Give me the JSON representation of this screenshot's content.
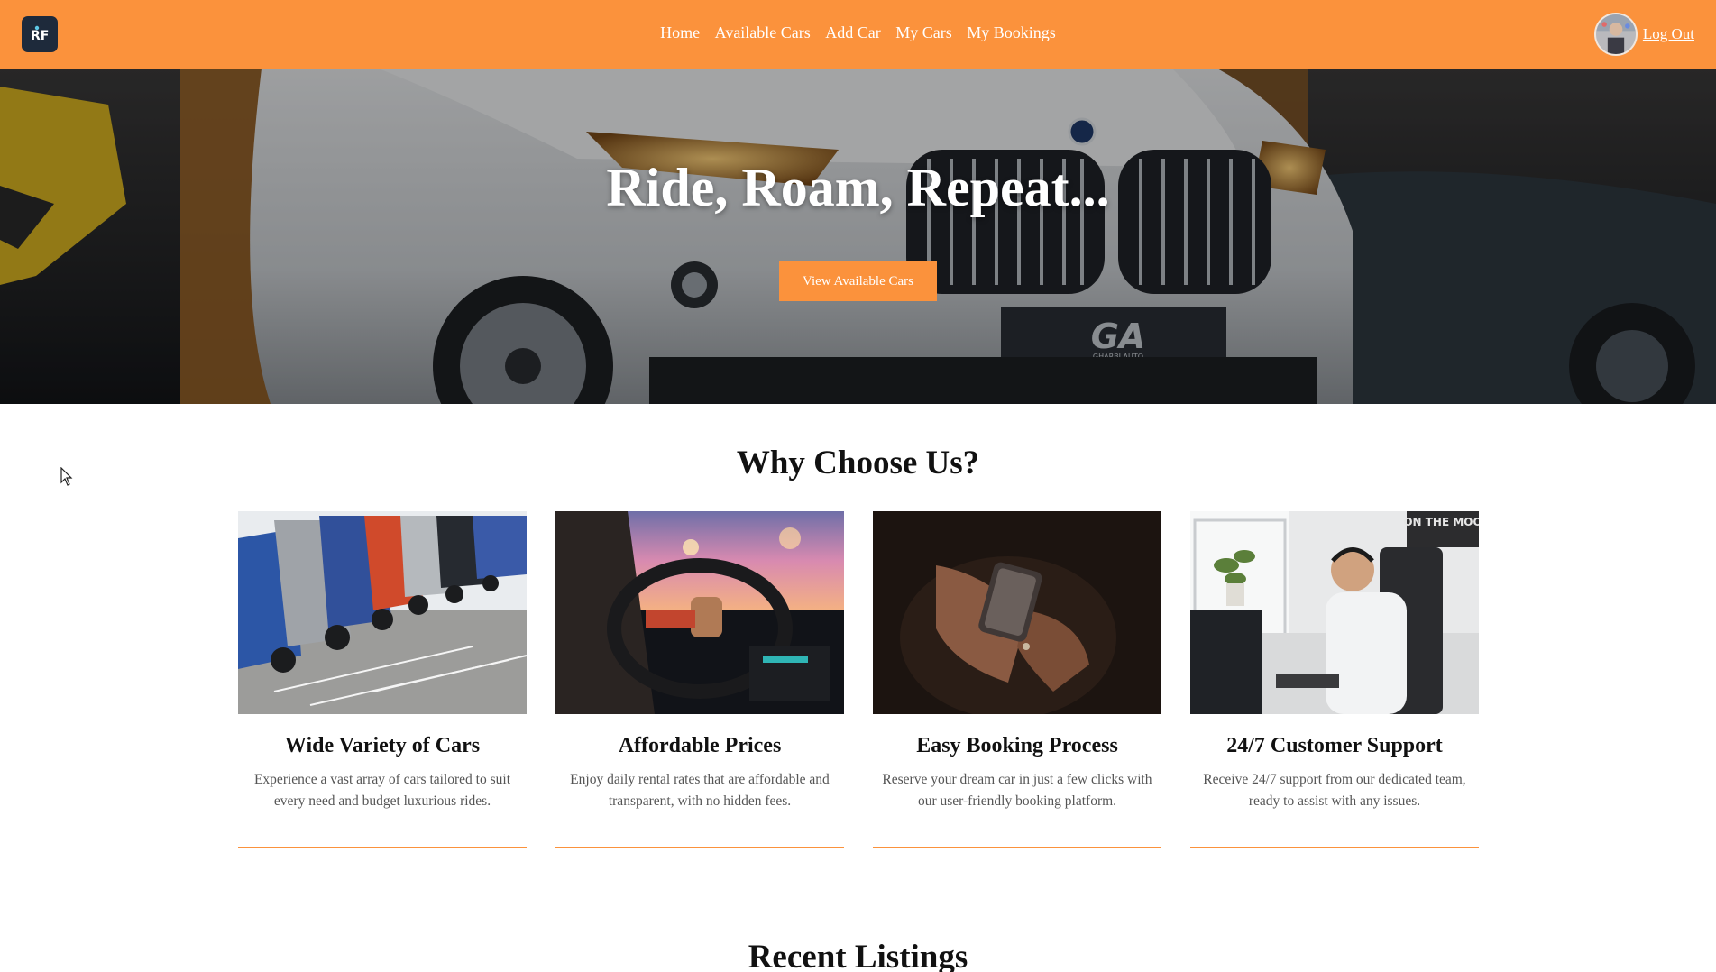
{
  "nav": {
    "logo_text": "RF",
    "links": [
      "Home",
      "Available Cars",
      "Add Car",
      "My Cars",
      "My Bookings"
    ],
    "logout_label": "Log Out"
  },
  "hero": {
    "title": "Ride, Roam, Repeat...",
    "button_label": "View Available Cars",
    "plate_text": "GA",
    "plate_sub": "GHARBI AUTO"
  },
  "why": {
    "title": "Why Choose Us?",
    "cards": [
      {
        "title": "Wide Variety of Cars",
        "description": "Experience a vast array of cars tailored to suit every need and budget luxurious rides.",
        "image": "parked-cars"
      },
      {
        "title": "Affordable Prices",
        "description": "Enjoy daily rental rates that are affordable and transparent, with no hidden fees.",
        "image": "driver-steering-wheel"
      },
      {
        "title": "Easy Booking Process",
        "description": "Reserve your dream car in just a few clicks with our user-friendly booking platform.",
        "image": "hand-holding-phone"
      },
      {
        "title": "24/7 Customer Support",
        "description": "Receive 24/7 support from our dedicated team, ready to assist with any issues.",
        "image": "support-agent-headset",
        "poster_text": "ON THE MOO"
      }
    ]
  },
  "recent": {
    "title": "Recent Listings"
  },
  "colors": {
    "accent": "#fb923c",
    "logo_bg": "#1e2a3b"
  }
}
